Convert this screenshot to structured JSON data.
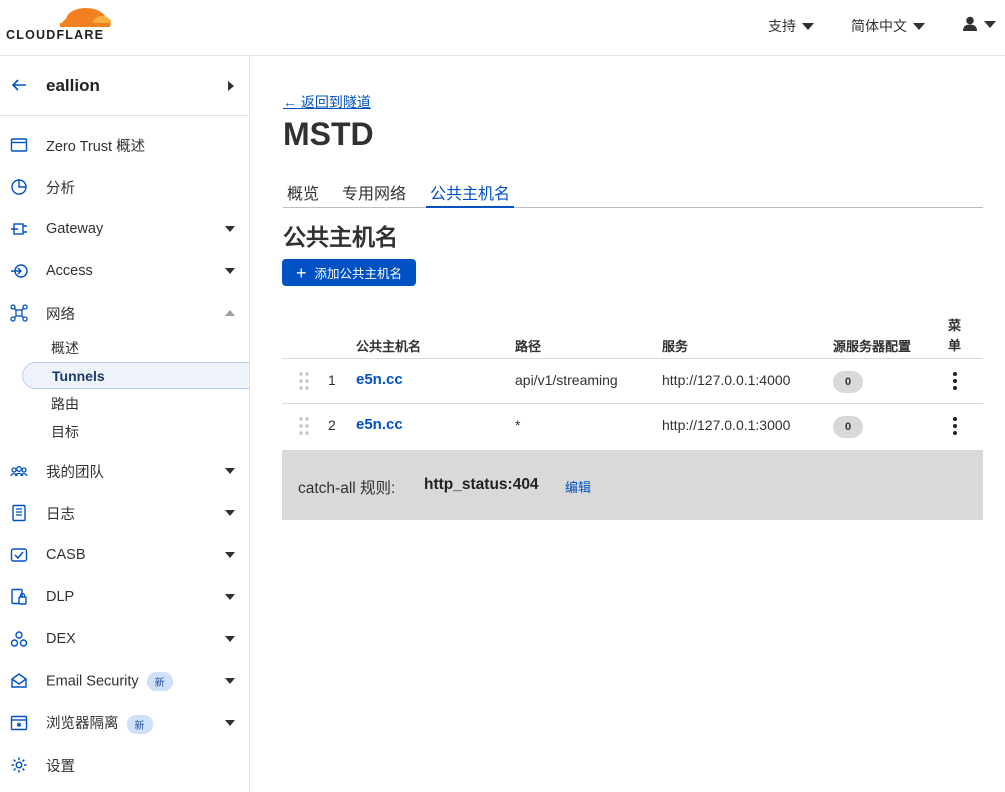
{
  "brand": {
    "name": "CLOUDFLARE",
    "orange": "#f38020",
    "light_orange": "#faae40"
  },
  "topbar": {
    "support": "支持",
    "language": "简体中文"
  },
  "account": {
    "name": "eallion"
  },
  "sidebar": {
    "items": [
      {
        "label": "Zero Trust 概述",
        "icon": "window-icon"
      },
      {
        "label": "分析",
        "icon": "pie-chart-icon"
      },
      {
        "label": "Gateway",
        "icon": "gateway-icon"
      },
      {
        "label": "Access",
        "icon": "access-icon"
      },
      {
        "label": "网络",
        "icon": "network-icon"
      },
      {
        "label": "我的团队",
        "icon": "team-icon"
      },
      {
        "label": "日志",
        "icon": "log-icon"
      },
      {
        "label": "CASB",
        "icon": "casb-icon"
      },
      {
        "label": "DLP",
        "icon": "dlp-icon"
      },
      {
        "label": "DEX",
        "icon": "dex-icon"
      },
      {
        "label": "Email Security",
        "icon": "email-security-icon",
        "badge": "新"
      },
      {
        "label": "浏览器隔离",
        "icon": "browser-isolation-icon",
        "badge": "新"
      },
      {
        "label": "设置",
        "icon": "gear-icon"
      }
    ],
    "network_sub": [
      "概述",
      "Tunnels",
      "路由",
      "目标"
    ]
  },
  "page": {
    "back_link": "← 返回到隧道",
    "title": "MSTD",
    "tabs": [
      "概览",
      "专用网络",
      "公共主机名"
    ],
    "section_title": "公共主机名",
    "add_button": "添加公共主机名"
  },
  "table": {
    "headers": {
      "hostname": "公共主机名",
      "path": "路径",
      "service": "服务",
      "origin": "源服务器配置",
      "menu": "菜单"
    },
    "rows": [
      {
        "num": "1",
        "hostname": "e5n.cc",
        "path": "api/v1/streaming",
        "service": "http://127.0.0.1:4000",
        "origin": "0"
      },
      {
        "num": "2",
        "hostname": "e5n.cc",
        "path": "*",
        "service": "http://127.0.0.1:3000",
        "origin": "0"
      }
    ],
    "catchall": {
      "label": "catch-all 规则:",
      "value": "http_status:404",
      "edit": "编辑"
    }
  }
}
